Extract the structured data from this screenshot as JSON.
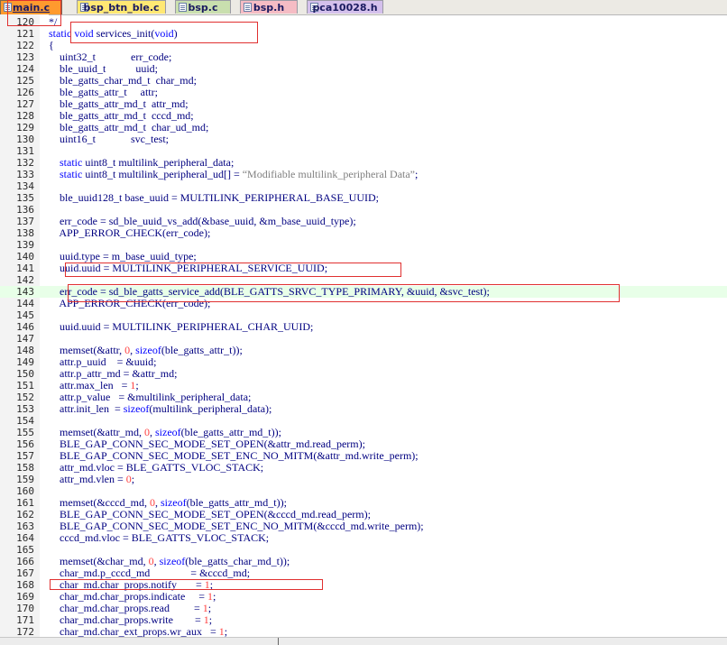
{
  "tabs": [
    {
      "label": "main.c",
      "active": true,
      "color": "#ff9a2e"
    },
    {
      "label": "bsp_btn_ble.c",
      "active": false,
      "color": "#ffe873"
    },
    {
      "label": "bsp.c",
      "active": false,
      "color": "#c9dfae"
    },
    {
      "label": "bsp.h",
      "active": false,
      "color": "#f5bcc4"
    },
    {
      "label": "pca10028.h",
      "active": false,
      "color": "#d4c0ec"
    }
  ],
  "lines": [
    {
      "num": "120",
      "code": "*/"
    },
    {
      "num": "121",
      "code": "static void services_init(void)"
    },
    {
      "num": "122",
      "code": "{"
    },
    {
      "num": "123",
      "code": "    uint32_t             err_code;"
    },
    {
      "num": "124",
      "code": "    ble_uuid_t           uuid;"
    },
    {
      "num": "125",
      "code": "    ble_gatts_char_md_t  char_md;"
    },
    {
      "num": "126",
      "code": "    ble_gatts_attr_t     attr;"
    },
    {
      "num": "127",
      "code": "    ble_gatts_attr_md_t  attr_md;"
    },
    {
      "num": "128",
      "code": "    ble_gatts_attr_md_t  cccd_md;"
    },
    {
      "num": "129",
      "code": "    ble_gatts_attr_md_t  char_ud_md;"
    },
    {
      "num": "130",
      "code": "    uint16_t             svc_test;"
    },
    {
      "num": "131",
      "code": ""
    },
    {
      "num": "132",
      "code": "    static uint8_t multilink_peripheral_data;"
    },
    {
      "num": "133",
      "code": "    static uint8_t multilink_peripheral_ud[] = \"Modifiable multilink_peripheral Data\";"
    },
    {
      "num": "134",
      "code": ""
    },
    {
      "num": "135",
      "code": "    ble_uuid128_t base_uuid = MULTILINK_PERIPHERAL_BASE_UUID;"
    },
    {
      "num": "136",
      "code": ""
    },
    {
      "num": "137",
      "code": "    err_code = sd_ble_uuid_vs_add(&base_uuid, &m_base_uuid_type);"
    },
    {
      "num": "138",
      "code": "    APP_ERROR_CHECK(err_code);"
    },
    {
      "num": "139",
      "code": ""
    },
    {
      "num": "140",
      "code": "    uuid.type = m_base_uuid_type;"
    },
    {
      "num": "141",
      "code": "    uuid.uuid = MULTILINK_PERIPHERAL_SERVICE_UUID;"
    },
    {
      "num": "142",
      "code": ""
    },
    {
      "num": "143",
      "code": "    err_code = sd_ble_gatts_service_add(BLE_GATTS_SRVC_TYPE_PRIMARY, &uuid, &svc_test);",
      "highlight": true
    },
    {
      "num": "144",
      "code": "    APP_ERROR_CHECK(err_code);"
    },
    {
      "num": "145",
      "code": ""
    },
    {
      "num": "146",
      "code": "    uuid.uuid = MULTILINK_PERIPHERAL_CHAR_UUID;"
    },
    {
      "num": "147",
      "code": ""
    },
    {
      "num": "148",
      "code": "    memset(&attr, 0, sizeof(ble_gatts_attr_t));"
    },
    {
      "num": "149",
      "code": "    attr.p_uuid    = &uuid;"
    },
    {
      "num": "150",
      "code": "    attr.p_attr_md = &attr_md;"
    },
    {
      "num": "151",
      "code": "    attr.max_len   = 1;"
    },
    {
      "num": "152",
      "code": "    attr.p_value   = &multilink_peripheral_data;"
    },
    {
      "num": "153",
      "code": "    attr.init_len  = sizeof(multilink_peripheral_data);"
    },
    {
      "num": "154",
      "code": ""
    },
    {
      "num": "155",
      "code": "    memset(&attr_md, 0, sizeof(ble_gatts_attr_md_t));"
    },
    {
      "num": "156",
      "code": "    BLE_GAP_CONN_SEC_MODE_SET_OPEN(&attr_md.read_perm);"
    },
    {
      "num": "157",
      "code": "    BLE_GAP_CONN_SEC_MODE_SET_ENC_NO_MITM(&attr_md.write_perm);"
    },
    {
      "num": "158",
      "code": "    attr_md.vloc = BLE_GATTS_VLOC_STACK;"
    },
    {
      "num": "159",
      "code": "    attr_md.vlen = 0;"
    },
    {
      "num": "160",
      "code": ""
    },
    {
      "num": "161",
      "code": "    memset(&cccd_md, 0, sizeof(ble_gatts_attr_md_t));"
    },
    {
      "num": "162",
      "code": "    BLE_GAP_CONN_SEC_MODE_SET_OPEN(&cccd_md.read_perm);"
    },
    {
      "num": "163",
      "code": "    BLE_GAP_CONN_SEC_MODE_SET_ENC_NO_MITM(&cccd_md.write_perm);"
    },
    {
      "num": "164",
      "code": "    cccd_md.vloc = BLE_GATTS_VLOC_STACK;"
    },
    {
      "num": "165",
      "code": ""
    },
    {
      "num": "166",
      "code": "    memset(&char_md, 0, sizeof(ble_gatts_char_md_t));"
    },
    {
      "num": "167",
      "code": "    char_md.p_cccd_md               = &cccd_md;"
    },
    {
      "num": "168",
      "code": "    char_md.char_props.notify       = 1;"
    },
    {
      "num": "169",
      "code": "    char_md.char_props.indicate     = 1;"
    },
    {
      "num": "170",
      "code": "    char_md.char_props.read         = 1;"
    },
    {
      "num": "171",
      "code": "    char_md.char_props.write        = 1;"
    },
    {
      "num": "172",
      "code": "    char_md.char_ext_props.wr_aux   = 1;"
    }
  ],
  "colors": {
    "keyword": "#0000ff",
    "identifier": "#000080",
    "string": "#808080",
    "number": "#ff4040",
    "annotation": "#e03030",
    "current_line": "#e8ffe8"
  }
}
